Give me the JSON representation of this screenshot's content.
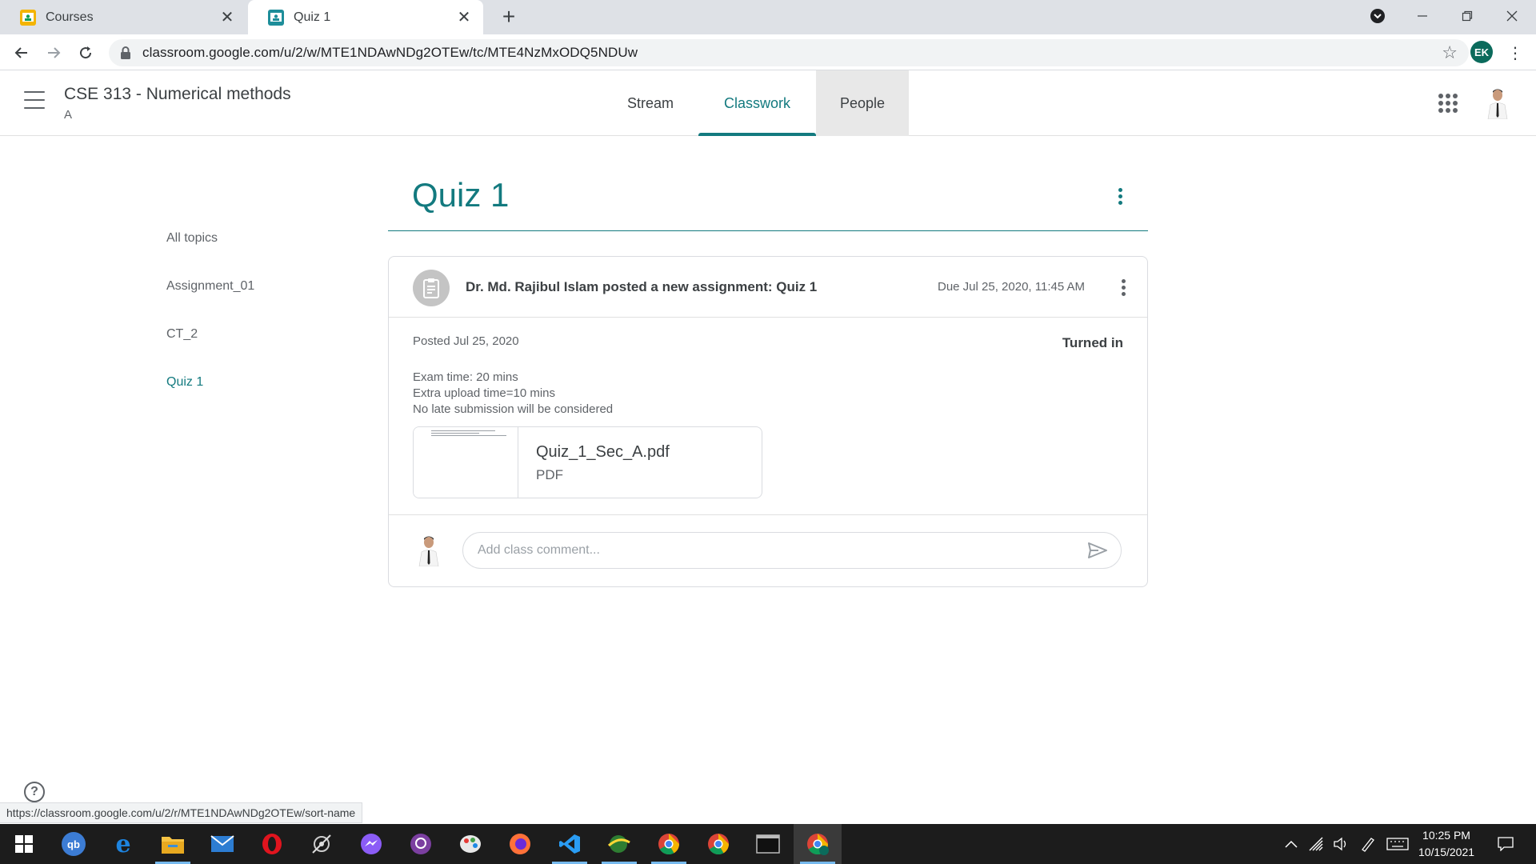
{
  "browser": {
    "tabs": [
      {
        "title": "Courses",
        "favicon": "classroom-yellow-icon",
        "color": "#f4b400"
      },
      {
        "title": "Quiz 1",
        "favicon": "classroom-assignment-icon",
        "color": "#1e8e9a"
      }
    ],
    "url": "classroom.google.com/u/2/w/MTE1NDAwNDg2OTEw/tc/MTE4NzMxODQ5NDUw",
    "profile_initials": "EK",
    "status_url": "https://classroom.google.com/u/2/r/MTE1NDAwNDg2OTEw/sort-name"
  },
  "header": {
    "course_title": "CSE 313 - Numerical methods",
    "section": "A",
    "tabs": [
      {
        "label": "Stream"
      },
      {
        "label": "Classwork",
        "active": true
      },
      {
        "label": "People",
        "hovered": true
      }
    ],
    "accent_color": "#137a7f"
  },
  "topics": [
    {
      "label": "All topics"
    },
    {
      "label": "Assignment_01"
    },
    {
      "label": "CT_2"
    },
    {
      "label": "Quiz 1",
      "active": true
    }
  ],
  "main": {
    "topic_heading": "Quiz 1",
    "assignment": {
      "posted_title": "Dr. Md. Rajibul Islam posted a new assignment: Quiz 1",
      "due": "Due Jul 25, 2020, 11:45 AM",
      "posted_date": "Posted Jul 25, 2020",
      "status": "Turned in",
      "description": [
        "Exam time: 20 mins",
        "Extra upload time=10 mins",
        "No late submission will be considered"
      ],
      "attachment": {
        "name": "Quiz_1_Sec_A.pdf",
        "type": "PDF"
      },
      "comment_placeholder": "Add class comment..."
    }
  },
  "taskbar": {
    "apps": [
      {
        "name": "windows-start-icon"
      },
      {
        "name": "qbittorrent-icon",
        "label": "qb"
      },
      {
        "name": "edge-icon",
        "label": "e"
      },
      {
        "name": "file-explorer-icon"
      },
      {
        "name": "mail-icon"
      },
      {
        "name": "opera-icon"
      },
      {
        "name": "satellite-app-icon"
      },
      {
        "name": "messenger-icon"
      },
      {
        "name": "github-desktop-icon"
      },
      {
        "name": "paint-app-icon"
      },
      {
        "name": "firefox-icon"
      },
      {
        "name": "vscode-icon"
      },
      {
        "name": "globe-app-icon"
      },
      {
        "name": "chrome-icon"
      },
      {
        "name": "chrome-icon"
      },
      {
        "name": "terminal-icon"
      },
      {
        "name": "chrome-profile-icon"
      }
    ],
    "time": "10:25 PM",
    "date": "10/15/2021"
  }
}
